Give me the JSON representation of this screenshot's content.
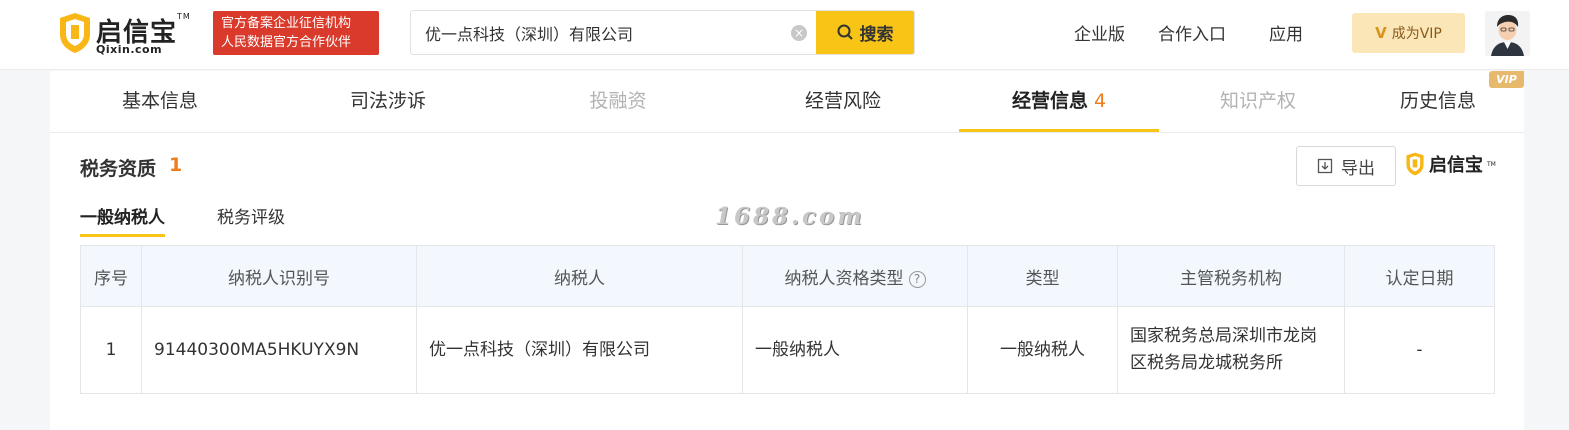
{
  "header": {
    "logo_cn": "启信宝",
    "logo_tm": "TM",
    "logo_en": "Qixin.com",
    "badge_line1": "官方备案企业征信机构",
    "badge_line2": "人民数据官方合作伙伴",
    "search_value": "优一点科技（深圳）有限公司",
    "search_button": "搜索",
    "nav": [
      "企业版",
      "合作入口",
      "应用"
    ],
    "vip_button": "成为VIP",
    "vip_icon": "V"
  },
  "tabs": [
    {
      "label": "基本信息"
    },
    {
      "label": "司法涉诉"
    },
    {
      "label": "投融资"
    },
    {
      "label": "经营风险"
    },
    {
      "label": "经营信息",
      "count": "4"
    },
    {
      "label": "知识产权"
    },
    {
      "label": "历史信息"
    }
  ],
  "vip_tag": "VIP",
  "section": {
    "title": "税务资质",
    "count": "1",
    "export_label": "导出",
    "brand": "启信宝",
    "subtabs": [
      "一般纳税人",
      "税务评级"
    ]
  },
  "watermark": "1688.com",
  "table": {
    "headers": [
      "序号",
      "纳税人识别号",
      "纳税人",
      "纳税人资格类型",
      "类型",
      "主管税务机构",
      "认定日期"
    ],
    "rows": [
      [
        "1",
        "91440300MA5HKUYX9N",
        "优一点科技（深圳）有限公司",
        "一般纳税人",
        "一般纳税人",
        "国家税务总局深圳市龙岗区税务局龙城税务所",
        "-"
      ]
    ]
  },
  "colors": {
    "accent": "#f8c517",
    "count": "#f07d1b",
    "badge": "#d93a2b",
    "table_header": "#f2f8fe"
  }
}
